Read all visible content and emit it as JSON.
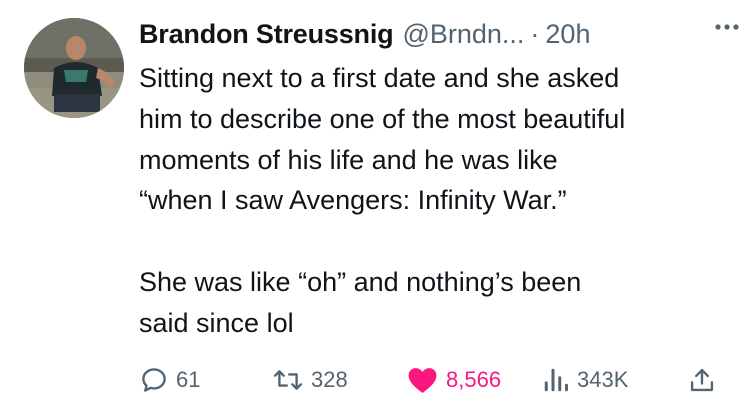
{
  "tweet": {
    "author_name": "Brandon Streussnig",
    "handle": "@Brndn...",
    "separator": "·",
    "time": "20h",
    "text": "Sitting next to a first date and she asked\nhim to describe one of the most beautiful\nmoments of his life and he was like\n“when I saw Avengers: Infinity War.”\n\nShe was like “oh” and nothing’s been\nsaid since lol"
  },
  "actions": {
    "replies": "61",
    "retweets": "328",
    "likes": "8,566",
    "views": "343K"
  },
  "icons": {
    "more": "more-horizontal-icon",
    "reply": "reply-icon",
    "retweet": "retweet-icon",
    "like": "heart-icon",
    "views": "views-icon",
    "share": "share-icon"
  },
  "colors": {
    "text": "#0f1419",
    "secondary": "#536471",
    "like": "#f91880"
  }
}
